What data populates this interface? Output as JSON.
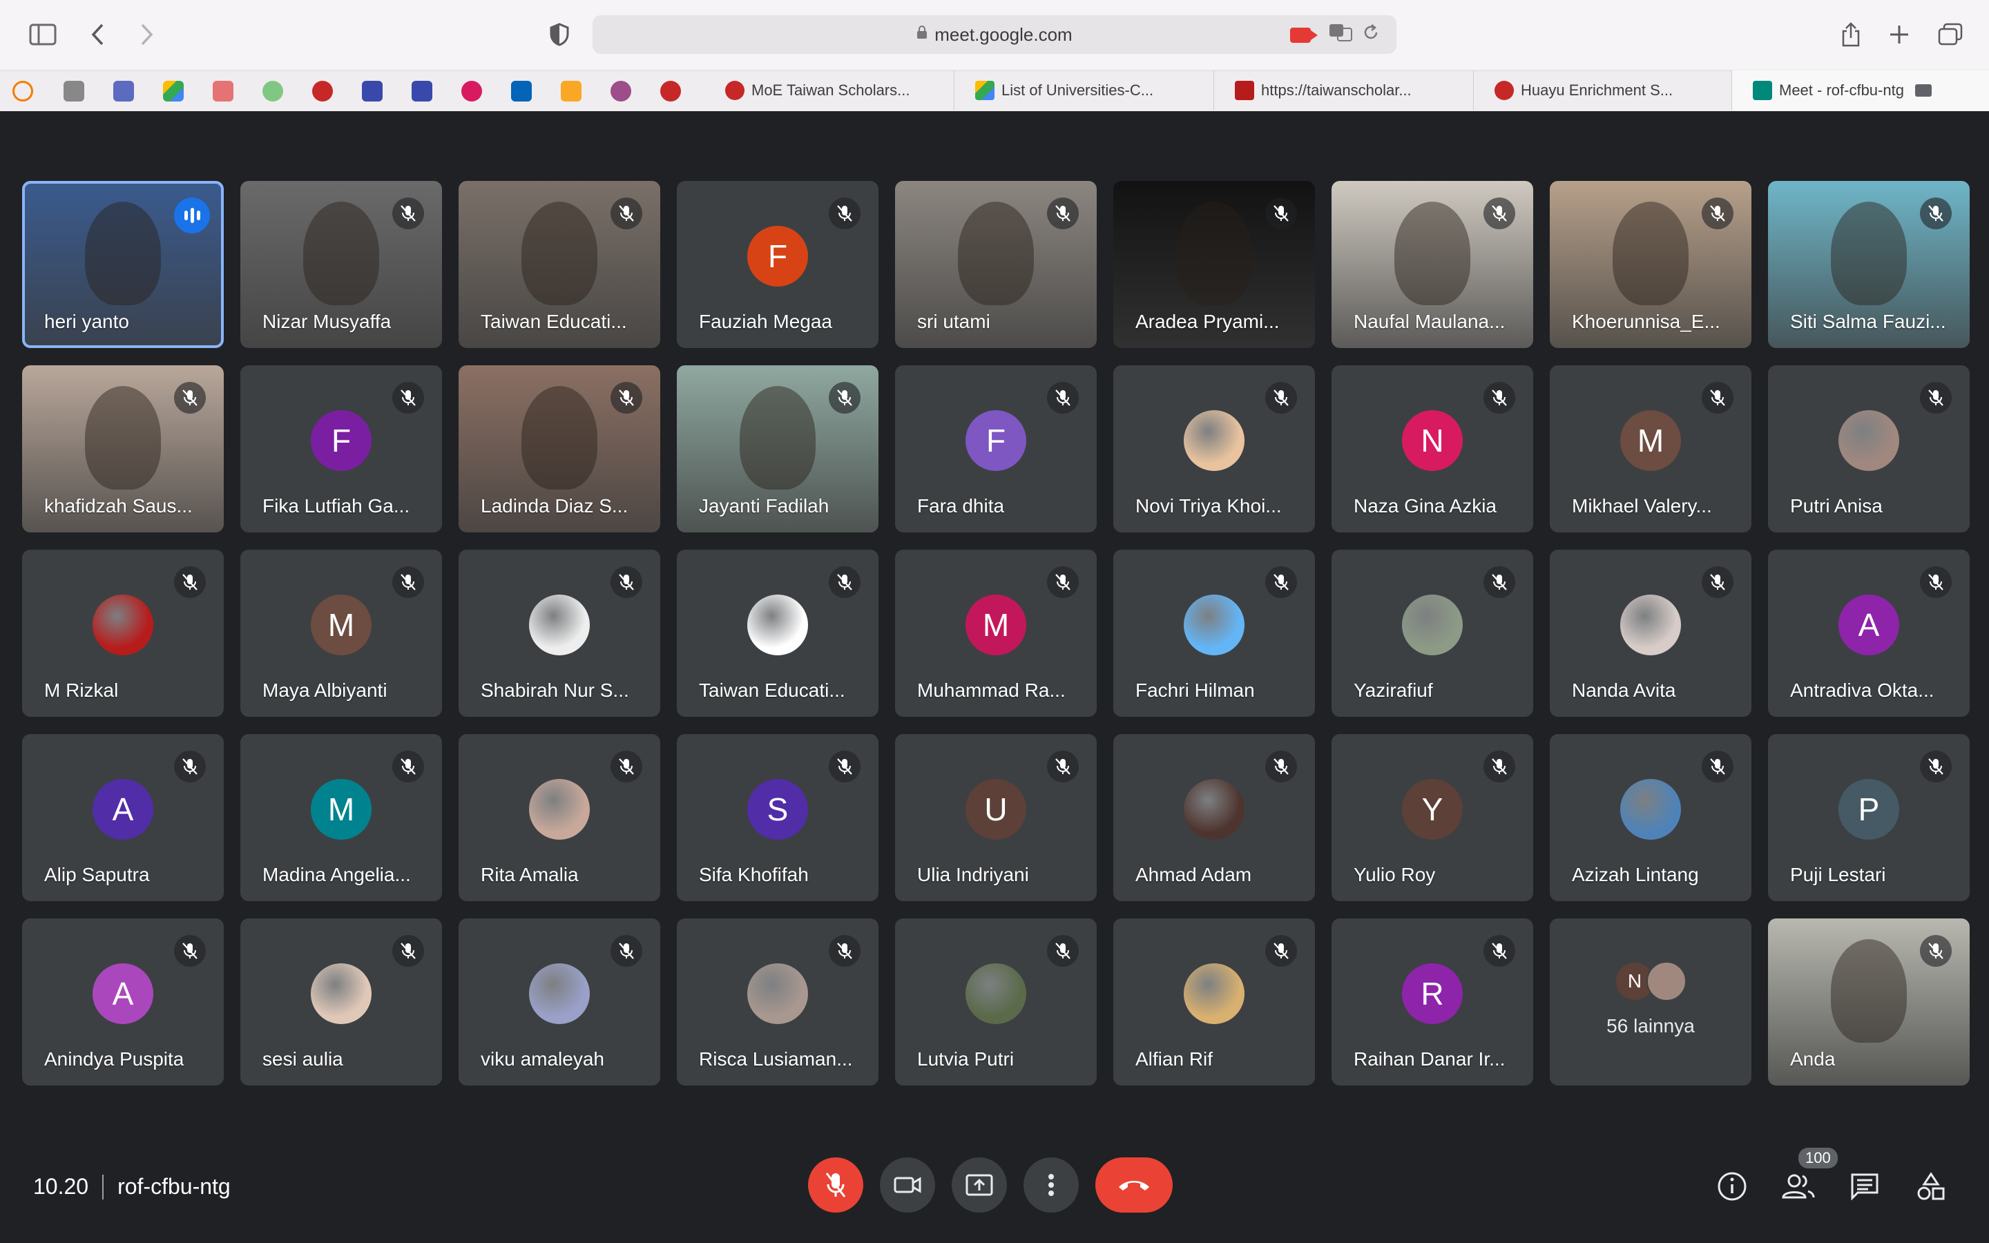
{
  "browser": {
    "url": "meet.google.com",
    "tabs": [
      {
        "label": "MoE Taiwan Scholars...",
        "fav_color": "#c62828"
      },
      {
        "label": "List of Universities-C...",
        "fav_color": "#34a853"
      },
      {
        "label": "https://taiwanscholar...",
        "fav_color": "#b71c1c"
      },
      {
        "label": "Huayu Enrichment S...",
        "fav_color": "#c62828"
      },
      {
        "label": "Meet - rof-cfbu-ntg",
        "fav_color": "#00897b"
      }
    ]
  },
  "participants": [
    {
      "name": "heri yanto",
      "kind": "video",
      "bg": "#3a5b8f",
      "speaking": true
    },
    {
      "name": "Nizar Musyaffa",
      "kind": "video",
      "bg": "#6a6a6a"
    },
    {
      "name": "Taiwan Educati...",
      "kind": "video",
      "bg": "#7a7068"
    },
    {
      "name": "Fauziah Megaa",
      "kind": "letter",
      "letter": "F",
      "color": "#d84315"
    },
    {
      "name": "sri utami",
      "kind": "video",
      "bg": "#8c8680"
    },
    {
      "name": "Aradea Pryami...",
      "kind": "video",
      "bg": "#121212"
    },
    {
      "name": "Naufal Maulana...",
      "kind": "video",
      "bg": "#cfc9c0"
    },
    {
      "name": "Khoerunnisa_E...",
      "kind": "video",
      "bg": "#b7a08a"
    },
    {
      "name": "Siti Salma Fauzi...",
      "kind": "video",
      "bg": "#6fb6c8"
    },
    {
      "name": "khafidzah Saus...",
      "kind": "video",
      "bg": "#b9a79a"
    },
    {
      "name": "Fika Lutfiah Ga...",
      "kind": "letter",
      "letter": "F",
      "color": "#7b1fa2"
    },
    {
      "name": "Ladinda Diaz S...",
      "kind": "video",
      "bg": "#8b7063"
    },
    {
      "name": "Jayanti Fadilah",
      "kind": "video",
      "bg": "#8fa8a0"
    },
    {
      "name": "Fara dhita",
      "kind": "letter",
      "letter": "F",
      "color": "#7e57c2"
    },
    {
      "name": "Novi Triya Khoi...",
      "kind": "photo",
      "color": "#e8c39e"
    },
    {
      "name": "Naza Gina Azkia",
      "kind": "letter",
      "letter": "N",
      "color": "#d81b60"
    },
    {
      "name": "Mikhael Valery...",
      "kind": "letter",
      "letter": "M",
      "color": "#6d4c41"
    },
    {
      "name": "Putri Anisa",
      "kind": "photo",
      "color": "#a1887f"
    },
    {
      "name": "M Rizkal",
      "kind": "photo",
      "color": "#b71c1c"
    },
    {
      "name": "Maya Albiyanti",
      "kind": "letter",
      "letter": "M",
      "color": "#6d4c41"
    },
    {
      "name": "Shabirah Nur S...",
      "kind": "photo",
      "color": "#eeeeee"
    },
    {
      "name": "Taiwan Educati...",
      "kind": "photo",
      "color": "#ffffff"
    },
    {
      "name": "Muhammad Ra...",
      "kind": "letter",
      "letter": "M",
      "color": "#c2185b"
    },
    {
      "name": "Fachri Hilman",
      "kind": "photo",
      "color": "#64b5f6"
    },
    {
      "name": "Yazirafiuf",
      "kind": "photo",
      "color": "#8d9a86"
    },
    {
      "name": "Nanda Avita",
      "kind": "photo",
      "color": "#d7ccc8"
    },
    {
      "name": "Antradiva Okta...",
      "kind": "letter",
      "letter": "A",
      "color": "#8e24aa"
    },
    {
      "name": "Alip Saputra",
      "kind": "letter",
      "letter": "A",
      "color": "#512da8"
    },
    {
      "name": "Madina Angelia...",
      "kind": "letter",
      "letter": "M",
      "color": "#00838f"
    },
    {
      "name": "Rita Amalia",
      "kind": "photo",
      "color": "#c8a89a"
    },
    {
      "name": "Sifa Khofifah",
      "kind": "letter",
      "letter": "S",
      "color": "#512da8"
    },
    {
      "name": "Ulia Indriyani",
      "kind": "letter",
      "letter": "U",
      "color": "#5d4037"
    },
    {
      "name": "Ahmad Adam",
      "kind": "photo",
      "color": "#4e342e"
    },
    {
      "name": "Yulio Roy",
      "kind": "letter",
      "letter": "Y",
      "color": "#5d4037"
    },
    {
      "name": "Azizah Lintang",
      "kind": "photo",
      "color": "#4f83b8"
    },
    {
      "name": "Puji Lestari",
      "kind": "letter",
      "letter": "P",
      "color": "#455a64"
    },
    {
      "name": "Anindya Puspita",
      "kind": "letter",
      "letter": "A",
      "color": "#ab47bc"
    },
    {
      "name": "sesi aulia",
      "kind": "photo",
      "color": "#e0c8b8"
    },
    {
      "name": "viku amaleyah",
      "kind": "photo",
      "color": "#9aa0c8"
    },
    {
      "name": "Risca Lusiaman...",
      "kind": "photo",
      "color": "#a89890"
    },
    {
      "name": "Lutvia Putri",
      "kind": "photo",
      "color": "#5a6a4a"
    },
    {
      "name": "Alfian Rif",
      "kind": "photo",
      "color": "#d8b070"
    },
    {
      "name": "Raihan Danar Ir...",
      "kind": "letter",
      "letter": "R",
      "color": "#8e24aa"
    },
    {
      "name": "56 lainnya",
      "kind": "more",
      "letter": "N"
    },
    {
      "name": "Anda",
      "kind": "video",
      "bg": "#b8b8b0"
    }
  ],
  "meeting": {
    "time": "10.20",
    "code": "rof-cfbu-ntg",
    "participants_count": "100"
  }
}
